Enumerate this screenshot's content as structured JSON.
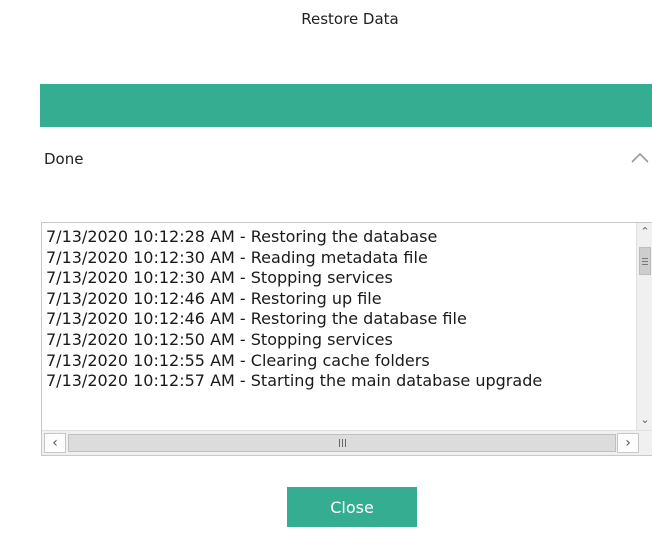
{
  "dialog": {
    "title": "Restore Data"
  },
  "progress": {
    "value": 1.0,
    "color": "#34ad91"
  },
  "status": {
    "text": "Done"
  },
  "log": {
    "lines": [
      "7/13/2020 10:12:28 AM - Restoring the database",
      "7/13/2020 10:12:30 AM - Reading metadata file",
      "7/13/2020 10:12:30 AM - Stopping services",
      "7/13/2020 10:12:46 AM - Restoring up file",
      "7/13/2020 10:12:46 AM - Restoring the database file",
      "7/13/2020 10:12:50 AM - Stopping services",
      "7/13/2020 10:12:55 AM - Clearing cache folders",
      "7/13/2020 10:12:57 AM - Starting the main database upgrade"
    ]
  },
  "buttons": {
    "close_label": "Close"
  },
  "colors": {
    "accent": "#34ad91"
  }
}
